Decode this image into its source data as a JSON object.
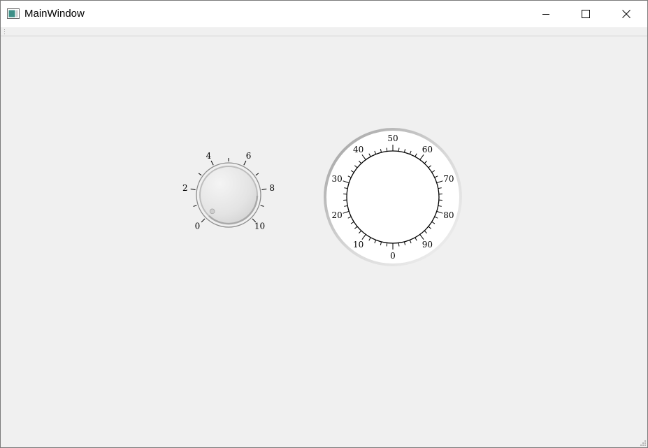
{
  "window": {
    "title": "MainWindow",
    "icon": "app-window-icon",
    "controls": [
      "minimize-icon",
      "maximize-icon",
      "close-icon"
    ]
  },
  "dial": {
    "min": 0,
    "max": 10,
    "value": 0,
    "labels": [
      "0",
      "2",
      "4",
      "6",
      "8",
      "10"
    ]
  },
  "gauge": {
    "min": 0,
    "max": 100,
    "labels": [
      "0",
      "10",
      "20",
      "30",
      "40",
      "50",
      "60",
      "70",
      "80",
      "90"
    ]
  },
  "colors": {
    "background": "#f0f0f0",
    "titlebar": "#ffffff",
    "gauge_face": "#ffffff",
    "gauge_rim": "#c8c8c8",
    "dial_knob": "#e6e6e6"
  }
}
